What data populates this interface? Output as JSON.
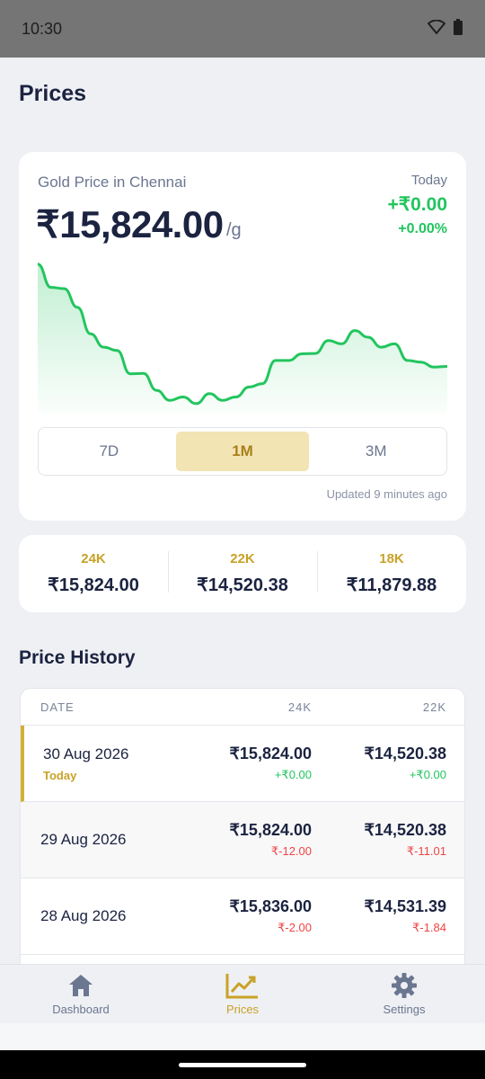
{
  "status_bar": {
    "time": "10:30"
  },
  "page": {
    "title": "Prices"
  },
  "price_card": {
    "city_label": "Gold Price in Chennai",
    "price": "₹15,824.00",
    "unit": "/g",
    "today_label": "Today",
    "change_abs": "+₹0.00",
    "change_pct": "+0.00%",
    "ranges": [
      "7D",
      "1M",
      "3M"
    ],
    "active_range": "1M",
    "updated": "Updated 9 minutes ago"
  },
  "chart_data": {
    "type": "area",
    "values": [
      16250,
      16180,
      16176,
      16120,
      16040,
      16000,
      15990,
      15920,
      15921,
      15870,
      15840,
      15850,
      15830,
      15860,
      15840,
      15850,
      15880,
      15890,
      15960,
      15960,
      15980,
      15981,
      16020,
      16010,
      16050,
      16030,
      16000,
      16010,
      15960,
      15955,
      15940,
      15942
    ],
    "line_color": "#22c55e",
    "fill_color": "#22c55e",
    "ylim": [
      15800,
      16260
    ],
    "grid": false
  },
  "karats": [
    {
      "label": "24K",
      "price": "₹15,824.00"
    },
    {
      "label": "22K",
      "price": "₹14,520.38"
    },
    {
      "label": "18K",
      "price": "₹11,879.88"
    }
  ],
  "history": {
    "title": "Price History",
    "headers": {
      "date": "DATE",
      "k24": "24K",
      "k22": "22K"
    },
    "rows": [
      {
        "date": "30 Aug 2026",
        "badge": "Today",
        "p24": "₹15,824.00",
        "d24": "+₹0.00",
        "p22": "₹14,520.38",
        "d22": "+₹0.00"
      },
      {
        "date": "29 Aug 2026",
        "p24": "₹15,824.00",
        "d24": "₹-12.00",
        "p22": "₹14,520.38",
        "d22": "₹-11.01"
      },
      {
        "date": "28 Aug 2026",
        "p24": "₹15,836.00",
        "d24": "₹-2.00",
        "p22": "₹14,531.39",
        "d22": "₹-1.84"
      }
    ]
  },
  "nav": {
    "items": [
      {
        "label": "Dashboard",
        "icon": "home-icon"
      },
      {
        "label": "Prices",
        "icon": "trending-up-icon"
      },
      {
        "label": "Settings",
        "icon": "gear-icon"
      }
    ],
    "active": "Prices"
  },
  "colors": {
    "accent_gold": "#c9a227",
    "positive": "#22c55e",
    "negative": "#ef4444",
    "text_primary": "#1b2340"
  }
}
